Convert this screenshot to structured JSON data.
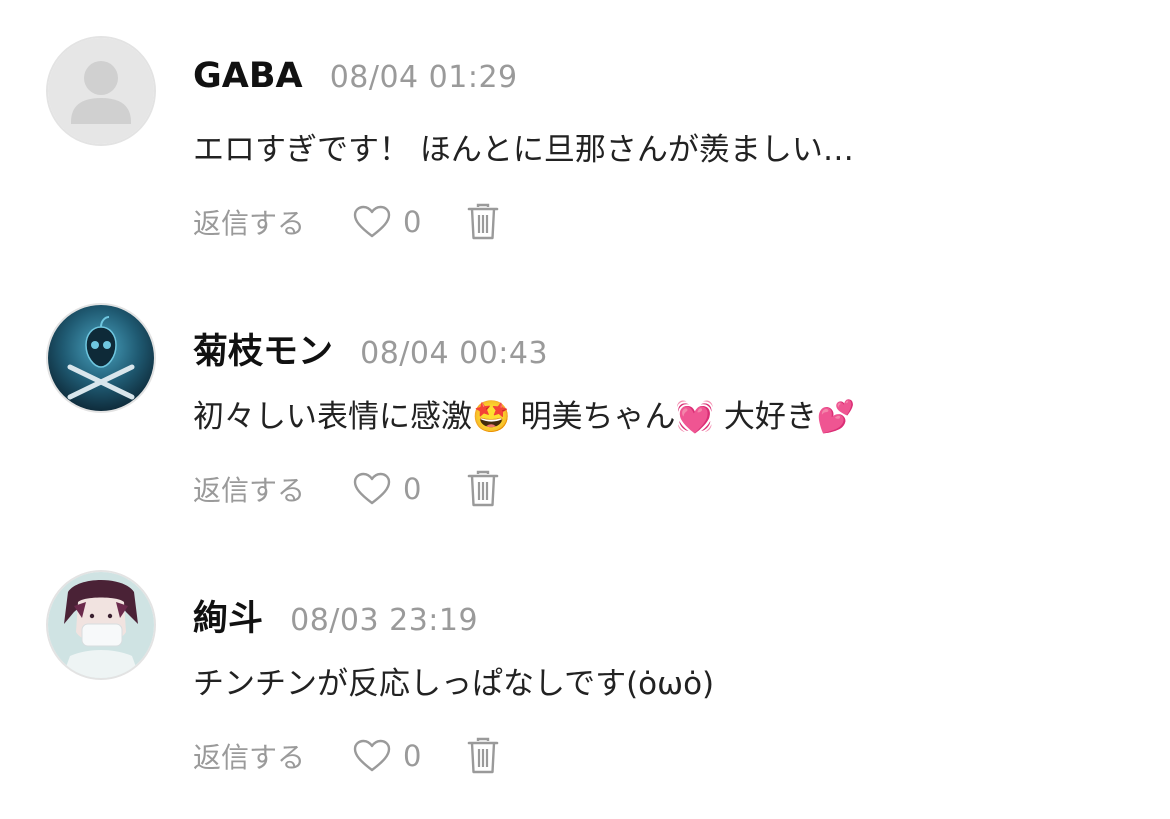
{
  "comments": [
    {
      "author": "GABA",
      "timestamp": "08/04 01:29",
      "text": "エロすぎです！ ほんとに旦那さんが羨ましい…",
      "avatar_icon": "default-user-icon",
      "reply_label": "返信する",
      "like_count": "0"
    },
    {
      "author": "菊枝モン",
      "timestamp": "08/04 00:43",
      "text": "初々しい表情に感激🤩 明美ちゃん💓 大好き💕",
      "avatar_icon": "skull-apple-avatar",
      "reply_label": "返信する",
      "like_count": "0"
    },
    {
      "author": "絢斗",
      "timestamp": "08/03 23:19",
      "text": "チンチンが反応しっぱなしです(ȯωȯ)",
      "avatar_icon": "person-photo-avatar",
      "reply_label": "返信する",
      "like_count": "0"
    }
  ],
  "colors": {
    "name": "#111111",
    "meta": "#9a9a9a",
    "avatar_border": "#e3e3e3"
  }
}
